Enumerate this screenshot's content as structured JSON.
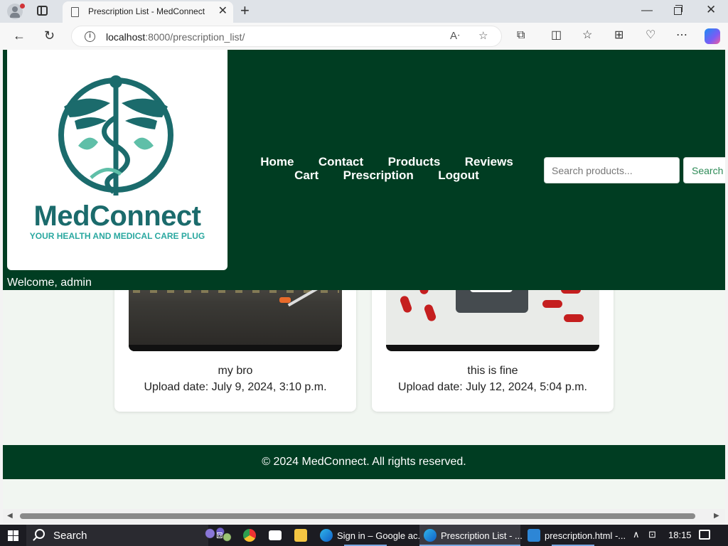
{
  "browser": {
    "tab_title": "Prescription List - MedConnect",
    "url_host": "localhost",
    "url_rest": ":8000/prescription_list/"
  },
  "site": {
    "logo_wordmark": "MedConnect",
    "logo_tagline": "YOUR HEALTH AND MEDICAL CARE PLUG",
    "welcome": "Welcome, admin",
    "nav": [
      "Home",
      "Contact",
      "Products",
      "Reviews",
      "Cart",
      "Prescription",
      "Logout"
    ],
    "search": {
      "placeholder": "Search products...",
      "button": "Search"
    },
    "accent_color": "#003d22",
    "footer": "© 2024 MedConnect. All rights reserved."
  },
  "prescriptions": [
    {
      "title": "my bro",
      "date": "Upload date: July 9, 2024, 3:10 p.m."
    },
    {
      "title": "this is fine",
      "date": "Upload date: July 12, 2024, 5:04 p.m."
    }
  ],
  "taskbar": {
    "search_label": "Search",
    "windows": [
      {
        "label": "Sign in – Google ac..."
      },
      {
        "label": "Prescription List - ..."
      },
      {
        "label": "prescription.html -..."
      }
    ],
    "time": "18:15"
  }
}
